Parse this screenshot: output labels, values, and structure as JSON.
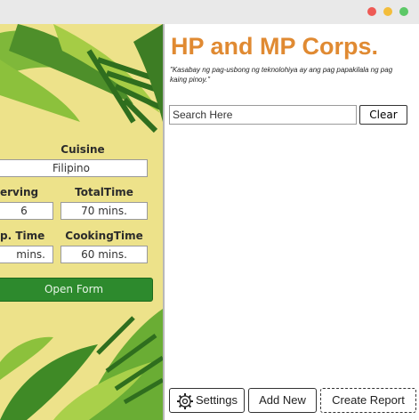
{
  "window": {
    "controls": [
      "close",
      "minimize",
      "maximize"
    ]
  },
  "recipe": {
    "cuisine_label": "Cuisine",
    "cuisine_value": "Filipino",
    "serving_label": "erving",
    "serving_value": "6",
    "totaltime_label": "TotalTime",
    "totaltime_value": "70 mins.",
    "preptime_label": "p. Time",
    "preptime_value": "mins.",
    "cookingtime_label": "CookingTime",
    "cookingtime_value": "60 mins.",
    "open_form_label": "Open Form"
  },
  "header": {
    "title": "HP and MP Corps.",
    "subtitle": "\"Kasabay ng pag-usbong ng teknolohiya ay ang pag papakilala ng pag kaing pinoy.\""
  },
  "search": {
    "value": "Search Here",
    "clear_label": "Clear"
  },
  "footer": {
    "settings_label": "Settings",
    "settings_icon": "gear-icon",
    "add_new_label": "Add New",
    "create_report_label": "Create Report"
  },
  "colors": {
    "title": "#e08a32",
    "open_button": "#2d8a2d",
    "panel_bg": "#ede28a"
  }
}
